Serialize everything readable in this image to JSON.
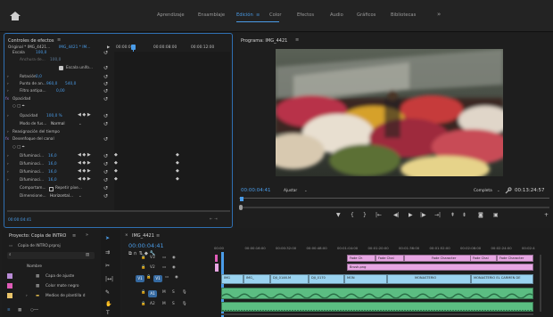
{
  "top_bar": {
    "workspaces": [
      "Aprendizaje",
      "Ensamblaje",
      "Edición",
      "Color",
      "Efectos",
      "Audio",
      "Gráficos",
      "Bibliotecas"
    ],
    "active_workspace": "Edición",
    "menu_glyph": "≡",
    "more_glyph": "»"
  },
  "effect_controls": {
    "title": "Controles de efectos",
    "menu": "≡",
    "source": "Original * IMG_4421...",
    "sequence": "IMG_4421 * IM...",
    "times": [
      "00:00:00",
      "00:00:08:00",
      "00:00:12:00"
    ],
    "rows": {
      "escala": {
        "label": "Escala",
        "value": "100,0"
      },
      "anchura": {
        "label": "Anchura de...",
        "value": "100,0"
      },
      "uniforme": {
        "label": "Escala unifo..."
      },
      "rotacion": {
        "label": "Rotación",
        "value": "0,0"
      },
      "punto": {
        "label": "Punto de an...",
        "value1": "960,0",
        "value2": "540,0"
      },
      "filtro": {
        "label": "Filtro antipa...",
        "value": "0,00"
      },
      "opacidad_group": {
        "label": "Opacidad"
      },
      "opacidad": {
        "label": "Opacidad",
        "value": "100,0 %"
      },
      "modo": {
        "label": "Modo de fus...",
        "value": "Normal"
      },
      "reasignacion": {
        "label": "Reasignación del tiempo"
      },
      "desenfoque": {
        "label": "Desenfoque del canal"
      },
      "difuminaciones": [
        {
          "label": "Difuminaci...",
          "value": "16,0"
        },
        {
          "label": "Difuminaci...",
          "value": "16,0"
        },
        {
          "label": "Difuminaci...",
          "value": "16,0"
        },
        {
          "label": "Difuminaci...",
          "value": "16,0"
        }
      ],
      "comportam": {
        "label": "Comportam...",
        "check": "Repetir píxe..."
      },
      "dimensiones": {
        "label": "Dimensione...",
        "value": "Horizontal..."
      }
    },
    "timecode": "00:00:04:41"
  },
  "program_monitor": {
    "title": "Programa: IMG_4421",
    "menu": "≡",
    "timecode": "00:00:04:41",
    "fit": "Ajustar",
    "quality": "Completa",
    "duration": "00:13:24:57"
  },
  "project": {
    "title": "Proyecto: Copia de INTRO",
    "menu": "≡",
    "more": "»",
    "file": "Copia de INTRO.prproj",
    "column_name": "Nombre",
    "items": [
      {
        "name": "Capa de ajuste",
        "color": "#b98bd6"
      },
      {
        "name": "Color mate negro",
        "color": "#e05cb8"
      },
      {
        "name": "Medios de plantilla d",
        "color": "#e9c46a"
      }
    ]
  },
  "timeline": {
    "tab": "IMG_4421",
    "menu": "≡",
    "timecode": "00:00:04:41",
    "ruler": [
      "00:00",
      "00:00:16:00",
      "00:00:32:00",
      "00:00:48:00",
      "00:01:04:00",
      "00:01:20:00",
      "00:01:36:00",
      "00:01:52:00",
      "00:02:08:00",
      "00:02:24:00",
      "00:02:4"
    ],
    "tracks": [
      "V3",
      "V2",
      "V1",
      "A1",
      "A2"
    ],
    "source_label": "V1",
    "upper_clips": [
      {
        "name": "Fade Ch",
        "color": "#e7a6e3"
      },
      {
        "name": "Fade Chai",
        "color": "#e7a6e3"
      },
      {
        "name": "Fade Character",
        "color": "#e7a6e3"
      },
      {
        "name": "Fade Chai",
        "color": "#e7a6e3"
      },
      {
        "name": "Fade Character",
        "color": "#e7a6e3"
      }
    ],
    "brush_clip": {
      "name": "Brush.png",
      "color": "#e7a6e3"
    },
    "v1_clips": [
      {
        "name": "IMG",
        "color": "#9ad3f0"
      },
      {
        "name": "IMG_",
        "color": "#9ad3f0"
      },
      {
        "name": "DJI_0146.M",
        "color": "#9ad3f0"
      },
      {
        "name": "DJI_0170",
        "color": "#9ad3f0"
      },
      {
        "name": "MON",
        "color": "#9ad3f0"
      },
      {
        "name": "MONASTERIO",
        "color": "#9ad3f0"
      },
      {
        "name": "MONASTERIO EL CARMEN DE",
        "color": "#9ad3f0"
      }
    ]
  },
  "icons": [
    "home-icon",
    "wrench-icon",
    "camera-icon",
    "play-icon",
    "pencil-icon",
    "hand-icon",
    "text-icon"
  ],
  "colors": {
    "accent": "#4a9ce8",
    "video_clip": "#9ad3f0",
    "graphics_clip": "#e7a6e3",
    "audio_clip": "#5bbd82"
  }
}
